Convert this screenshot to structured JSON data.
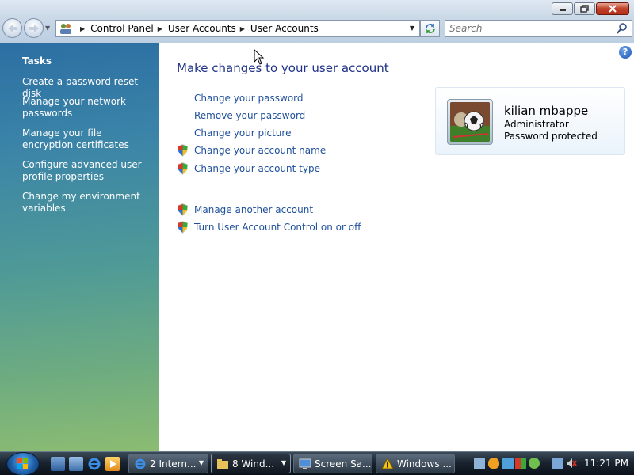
{
  "window": {
    "minimize_icon": "minimize-icon",
    "maximize_icon": "maximize-icon",
    "close_icon": "close-icon"
  },
  "navigation": {
    "breadcrumbs": [
      "Control Panel",
      "User Accounts",
      "User Accounts"
    ],
    "search_placeholder": "Search"
  },
  "tasks": {
    "title": "Tasks",
    "items": [
      "Create a password reset disk",
      "Manage your network passwords",
      "Manage your file encryption certificates",
      "Configure advanced user profile properties",
      "Change my environment variables"
    ]
  },
  "main": {
    "heading": "Make changes to your user account",
    "links": [
      {
        "label": "Change your password",
        "shield": false
      },
      {
        "label": "Remove your password",
        "shield": false
      },
      {
        "label": "Change your picture",
        "shield": false
      },
      {
        "label": "Change your account name",
        "shield": true
      },
      {
        "label": "Change your account type",
        "shield": true
      }
    ],
    "other_links": [
      {
        "label": "Manage another account",
        "shield": true
      },
      {
        "label": "Turn User Account Control on or off",
        "shield": true
      }
    ],
    "user": {
      "name": "kilian mbappe",
      "role": "Administrator",
      "status": "Password protected"
    }
  },
  "taskbar": {
    "buttons": [
      {
        "label": "2 Intern...",
        "icon": "internet-explorer-icon"
      },
      {
        "label": "8 Wind...",
        "icon": "folder-icon"
      },
      {
        "label": "Screen Sa...",
        "icon": "screen-saver-icon"
      },
      {
        "label": "Windows ...",
        "icon": "warning-icon"
      }
    ],
    "clock": "11:21 PM"
  },
  "colors": {
    "link": "#1e4f9a",
    "heading": "#1e3287",
    "taskpane_top": "#2c6fa3",
    "taskpane_bottom": "#8cbc72"
  }
}
